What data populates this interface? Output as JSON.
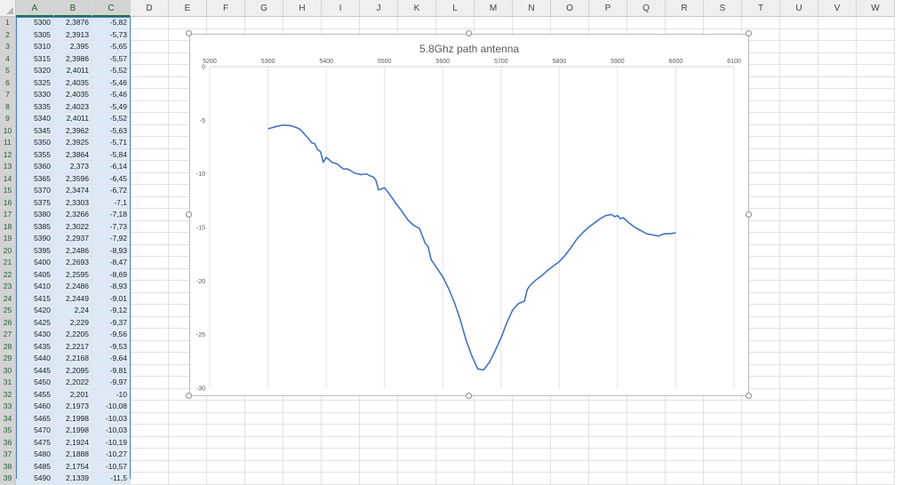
{
  "spreadsheet": {
    "columns": [
      "A",
      "B",
      "C",
      "D",
      "E",
      "F",
      "G",
      "H",
      "I",
      "J",
      "K",
      "L",
      "M",
      "N",
      "O",
      "P",
      "Q",
      "R",
      "S",
      "T",
      "U",
      "V",
      "W"
    ],
    "selected_columns": [
      "A",
      "B",
      "C"
    ],
    "rows": [
      [
        "5300",
        "2,3876",
        "-5,82"
      ],
      [
        "5305",
        "2,3913",
        "-5,73"
      ],
      [
        "5310",
        "2,395",
        "-5,65"
      ],
      [
        "5315",
        "2,3986",
        "-5,57"
      ],
      [
        "5320",
        "2,4011",
        "-5,52"
      ],
      [
        "5325",
        "2,4035",
        "-5,46"
      ],
      [
        "5330",
        "2,4035",
        "-5,46"
      ],
      [
        "5335",
        "2,4023",
        "-5,49"
      ],
      [
        "5340",
        "2,4011",
        "-5,52"
      ],
      [
        "5345",
        "2,3962",
        "-5,63"
      ],
      [
        "5350",
        "2,3925",
        "-5,71"
      ],
      [
        "5355",
        "2,3864",
        "-5,84"
      ],
      [
        "5360",
        "2,373",
        "-6,14"
      ],
      [
        "5365",
        "2,3596",
        "-6,45"
      ],
      [
        "5370",
        "2,3474",
        "-6,72"
      ],
      [
        "5375",
        "2,3303",
        "-7,1"
      ],
      [
        "5380",
        "2,3266",
        "-7,18"
      ],
      [
        "5385",
        "2,3022",
        "-7,73"
      ],
      [
        "5390",
        "2,2937",
        "-7,92"
      ],
      [
        "5395",
        "2,2486",
        "-8,93"
      ],
      [
        "5400",
        "2,2693",
        "-8,47"
      ],
      [
        "5405",
        "2,2595",
        "-8,69"
      ],
      [
        "5410",
        "2,2486",
        "-8,93"
      ],
      [
        "5415",
        "2,2449",
        "-9,01"
      ],
      [
        "5420",
        "2,24",
        "-9,12"
      ],
      [
        "5425",
        "2,229",
        "-9,37"
      ],
      [
        "5430",
        "2,2205",
        "-9,56"
      ],
      [
        "5435",
        "2,2217",
        "-9,53"
      ],
      [
        "5440",
        "2,2168",
        "-9,64"
      ],
      [
        "5445",
        "2,2095",
        "-9,81"
      ],
      [
        "5450",
        "2,2022",
        "-9,97"
      ],
      [
        "5455",
        "2,201",
        "-10"
      ],
      [
        "5460",
        "2,1973",
        "-10,08"
      ],
      [
        "5465",
        "2,1998",
        "-10,03"
      ],
      [
        "5470",
        "2,1998",
        "-10,03"
      ],
      [
        "5475",
        "2,1924",
        "-10,19"
      ],
      [
        "5480",
        "2,1888",
        "-10,27"
      ],
      [
        "5485",
        "2,1754",
        "-10,57"
      ],
      [
        "5490",
        "2,1339",
        "-11,5"
      ]
    ]
  },
  "chart_data": {
    "type": "line",
    "title": "5.8Ghz path antenna",
    "xlabel": "",
    "ylabel": "",
    "xlim": [
      5200,
      6100
    ],
    "ylim": [
      -30,
      0
    ],
    "x_ticks": [
      "5200",
      "5300",
      "5400",
      "5500",
      "5600",
      "5700",
      "5800",
      "5900",
      "6000",
      "6100"
    ],
    "y_ticks": [
      "0",
      "-5",
      "-10",
      "-15",
      "-20",
      "-25",
      "-30"
    ],
    "grid": "vertical",
    "legend": "none",
    "series_color": "#4472c4",
    "series": [
      {
        "x": [
          5300,
          5305,
          5310,
          5315,
          5320,
          5325,
          5330,
          5335,
          5340,
          5345,
          5350,
          5355,
          5360,
          5365,
          5370,
          5375,
          5380,
          5385,
          5390,
          5395,
          5400,
          5405,
          5410,
          5415,
          5420,
          5425,
          5430,
          5435,
          5440,
          5445,
          5450,
          5455,
          5460,
          5465,
          5470,
          5475,
          5480,
          5485,
          5490,
          5500,
          5510,
          5520,
          5530,
          5540,
          5550,
          5560,
          5570,
          5575,
          5580,
          5590,
          5600,
          5610,
          5620,
          5630,
          5640,
          5650,
          5660,
          5670,
          5680,
          5690,
          5700,
          5710,
          5720,
          5730,
          5740,
          5745,
          5750,
          5760,
          5770,
          5780,
          5790,
          5800,
          5810,
          5820,
          5830,
          5840,
          5850,
          5860,
          5870,
          5880,
          5890,
          5895,
          5900,
          5905,
          5910,
          5920,
          5930,
          5940,
          5950,
          5960,
          5970,
          5980,
          5990,
          6000
        ],
        "y": [
          -5.82,
          -5.73,
          -5.65,
          -5.57,
          -5.52,
          -5.46,
          -5.46,
          -5.49,
          -5.52,
          -5.63,
          -5.71,
          -5.84,
          -6.14,
          -6.45,
          -6.72,
          -7.1,
          -7.18,
          -7.73,
          -7.92,
          -8.93,
          -8.47,
          -8.69,
          -8.93,
          -9.01,
          -9.12,
          -9.37,
          -9.56,
          -9.53,
          -9.64,
          -9.81,
          -9.97,
          -10,
          -10.08,
          -10.03,
          -10.03,
          -10.19,
          -10.27,
          -10.57,
          -11.5,
          -11.3,
          -12.0,
          -12.8,
          -13.5,
          -14.3,
          -14.8,
          -15.1,
          -16.5,
          -16.8,
          -18.0,
          -18.8,
          -19.6,
          -20.7,
          -22.0,
          -23.6,
          -25.5,
          -27.0,
          -28.2,
          -28.3,
          -27.6,
          -26.5,
          -25.3,
          -23.9,
          -22.7,
          -22.1,
          -21.9,
          -20.8,
          -20.4,
          -19.9,
          -19.5,
          -19.0,
          -18.6,
          -18.2,
          -17.6,
          -16.9,
          -16.1,
          -15.5,
          -15.0,
          -14.6,
          -14.2,
          -13.9,
          -13.8,
          -14.0,
          -13.9,
          -14.2,
          -14.1,
          -14.6,
          -15.0,
          -15.3,
          -15.6,
          -15.7,
          -15.8,
          -15.6,
          -15.6,
          -15.5
        ]
      }
    ]
  }
}
